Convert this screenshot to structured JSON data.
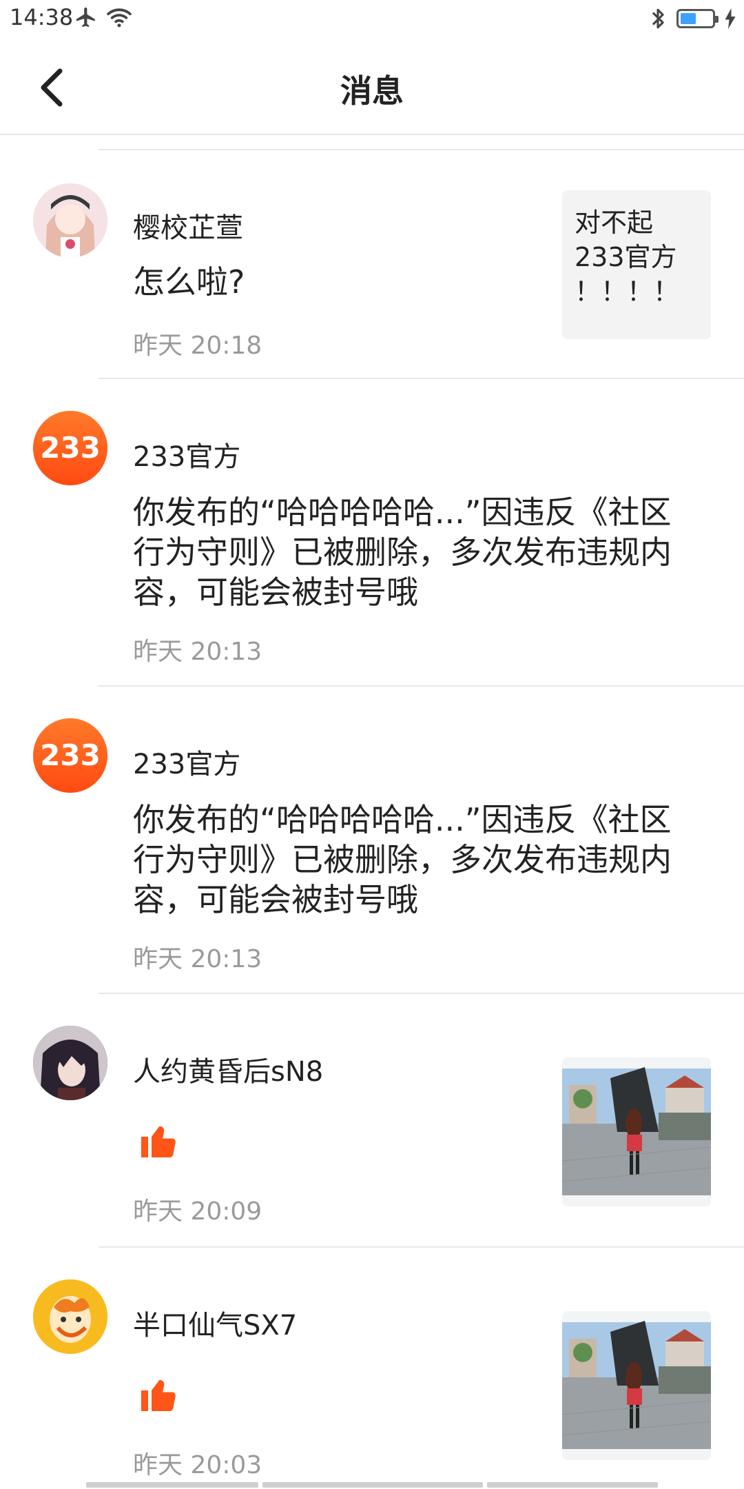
{
  "status": {
    "time": "14:38"
  },
  "header": {
    "title": "消息"
  },
  "messages": [
    {
      "user": "樱校芷萱",
      "text": "怎么啦?",
      "time": "昨天 20:18",
      "quote": "对不起\n233官方\n！！！！",
      "avatar": "anime-girl-avatar"
    },
    {
      "user": "233官方",
      "text": "你发布的“哈哈哈哈哈...”因违反《社区行为守则》已被删除，多次发布违规内容，可能会被封号哦",
      "time": "昨天 20:13",
      "avatar": "233-logo",
      "avatar_text": "233"
    },
    {
      "user": "233官方",
      "text": "你发布的“哈哈哈哈哈...”因违反《社区行为守则》已被删除，多次发布违规内容，可能会被封号哦",
      "time": "昨天 20:13",
      "avatar": "233-logo",
      "avatar_text": "233"
    },
    {
      "user": "人约黄昏后sN8",
      "time": "昨天 20:09",
      "action": "thumbs-up-icon",
      "avatar": "anime-boy-avatar",
      "thumbnail": "game-screenshot"
    },
    {
      "user": "半口仙气SX7",
      "time": "昨天 20:03",
      "action": "thumbs-up-icon",
      "avatar": "orange-cartoon-avatar",
      "thumbnail": "game-screenshot"
    }
  ],
  "colors": {
    "brand_orange": "#ff5a1f",
    "like_orange": "#ff5516",
    "divider": "#e8e8e8",
    "time_gray": "#9a9a9a"
  }
}
